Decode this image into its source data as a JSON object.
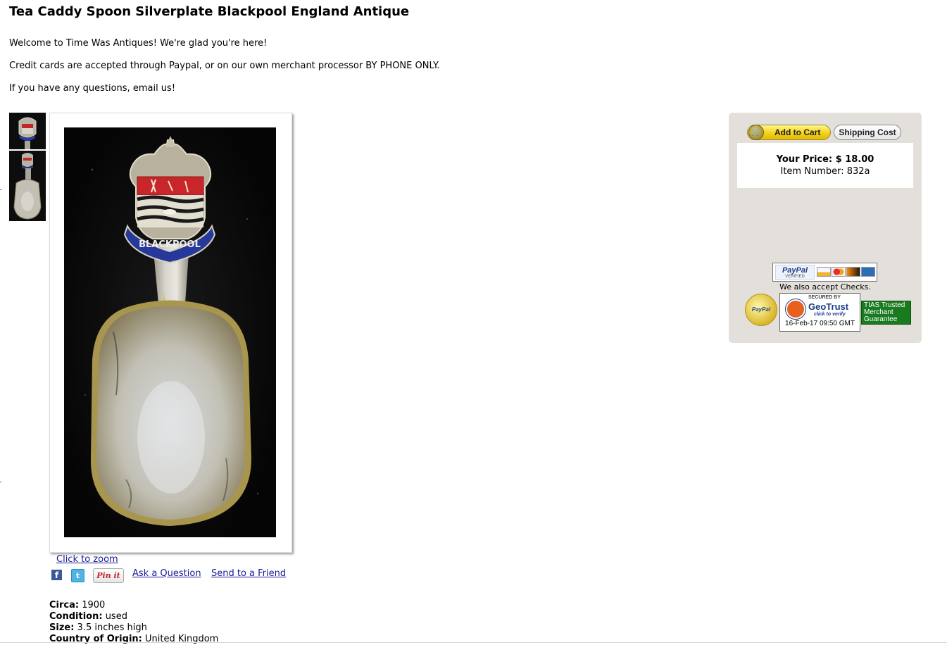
{
  "page": {
    "title": "Tea Caddy Spoon Silverplate Blackpool England Antique",
    "intro": [
      "Welcome to Time Was Antiques! We're glad you're here!",
      "Credit cards are accepted through Paypal, or on our own merchant processor BY PHONE ONLY.",
      "If you have any questions, email us!"
    ]
  },
  "gallery": {
    "thumbnails": [
      "spoon-crest-closeup",
      "spoon-full"
    ],
    "main_image": "silver-caddy-spoon-blackpool-crest",
    "crest_banner_text": "BLACKPOOL",
    "zoom_label": "Click to zoom"
  },
  "actions": {
    "facebook_icon": "f",
    "twitter_icon": "t",
    "pinit_label": "Pin it",
    "ask_label": "Ask a Question",
    "send_label": "Send to a Friend"
  },
  "details": [
    {
      "label": "Circa:",
      "value": "1900"
    },
    {
      "label": "Condition:",
      "value": "used"
    },
    {
      "label": "Size:",
      "value": "3.5 inches high"
    },
    {
      "label": "Country of Origin:",
      "value": "United Kingdom"
    }
  ],
  "cart": {
    "add_to_cart_label": "Add to Cart",
    "shipping_label": "Shipping Cost",
    "price_line": "Your Price: $ 18.00",
    "item_line": "Item Number: 832a",
    "paypal_logo": "PayPal",
    "paypal_verified_small": "VERIFIED",
    "checks_note": "We also accept Checks.",
    "seal_text": "PayPal",
    "geotrust": {
      "secured_by": "SECURED BY",
      "name": "GeoTrust",
      "verify": "click to verify",
      "date": "16-Feb-17 09:50 GMT"
    },
    "tias_lines": [
      "TIAS Trusted",
      "Merchant",
      "Guarantee"
    ]
  },
  "colors": {
    "link": "#1a1a9a",
    "panel_bg": "#e3e0dc",
    "cart_button": "#f2d21a",
    "tias_green": "#1a7a1f"
  }
}
